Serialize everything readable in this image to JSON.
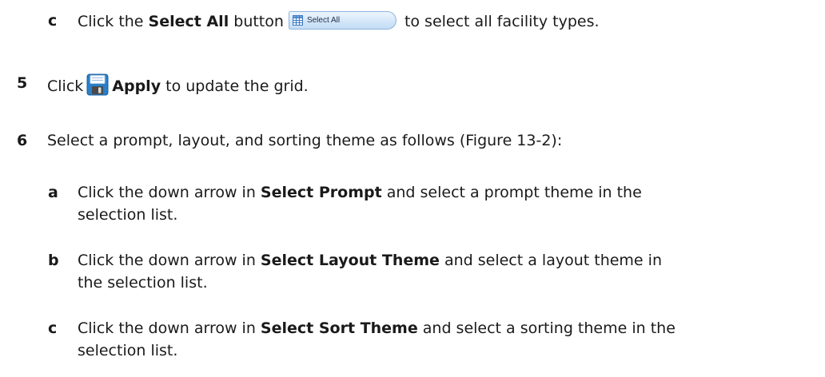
{
  "steps": {
    "c1": {
      "marker": "c",
      "before": "Click the ",
      "bold": "Select All",
      "mid": " button",
      "button_label": "Select All",
      "after": "to select all facility types."
    },
    "s5": {
      "marker": "5",
      "before": "Click",
      "bold": "Apply",
      "after": " to update the grid."
    },
    "s6": {
      "marker": "6",
      "text": "Select a prompt, layout, and sorting theme as follows (Figure 13-2):"
    },
    "a": {
      "marker": "a",
      "before": "Click the down arrow in ",
      "bold": "Select Prompt",
      "after": " and select a prompt theme in the",
      "line2": "selection list."
    },
    "b": {
      "marker": "b",
      "before": "Click the down arrow in ",
      "bold": "Select Layout Theme",
      "after": " and select a layout theme in",
      "line2": "the selection list."
    },
    "c2": {
      "marker": "c",
      "before": "Click the down arrow in ",
      "bold": "Select Sort Theme",
      "after": " and select a sorting theme in the",
      "line2": "selection list."
    }
  },
  "icons": {
    "grid": "grid-icon",
    "save": "save-icon"
  },
  "colors": {
    "text": "#1a1a1a",
    "button_border": "#8fb3dc",
    "button_fill": "#d3e6f8",
    "save_icon_blue": "#2a7fc8"
  }
}
